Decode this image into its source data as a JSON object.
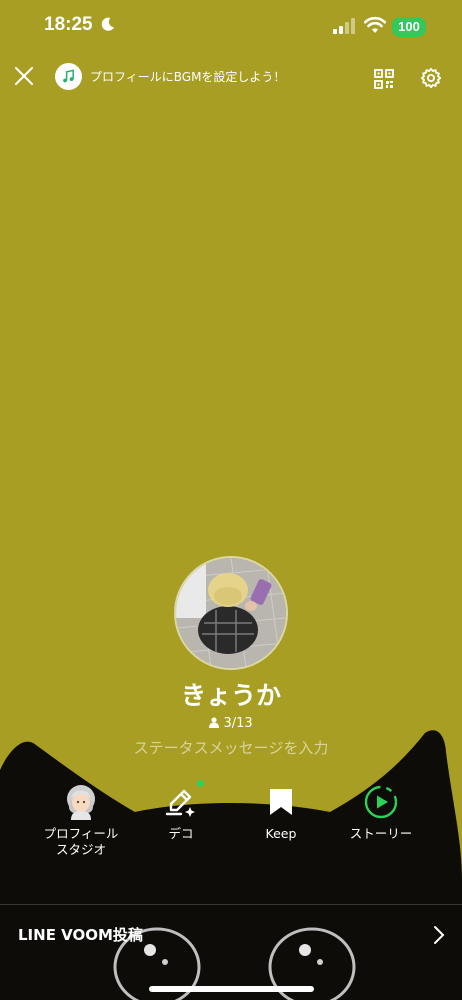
{
  "status_bar": {
    "time": "18:25",
    "battery": "100",
    "icons": [
      "moon-icon",
      "signal-icon",
      "wifi-icon"
    ]
  },
  "top_bar": {
    "close_icon": "close-icon",
    "bgm_prompt": "プロフィールにBGMを設定しよう！",
    "qr_icon": "qr-code-icon",
    "settings_icon": "gear-icon"
  },
  "profile": {
    "name": "きょうか",
    "followers_count": "3/13",
    "status_placeholder": "ステータスメッセージを入力"
  },
  "actions": [
    {
      "label": "プロフィール\nスタジオ",
      "icon": "avatar-studio-icon"
    },
    {
      "label": "デコ",
      "icon": "deco-pencil-icon",
      "has_badge": true
    },
    {
      "label": "Keep",
      "icon": "bookmark-icon"
    },
    {
      "label": "ストーリー",
      "icon": "story-play-icon"
    }
  ],
  "voom": {
    "label": "LINE VOOM投稿"
  },
  "colors": {
    "background": "#a89e23",
    "badge_green": "#2ed158",
    "battery_green": "#34c759"
  }
}
